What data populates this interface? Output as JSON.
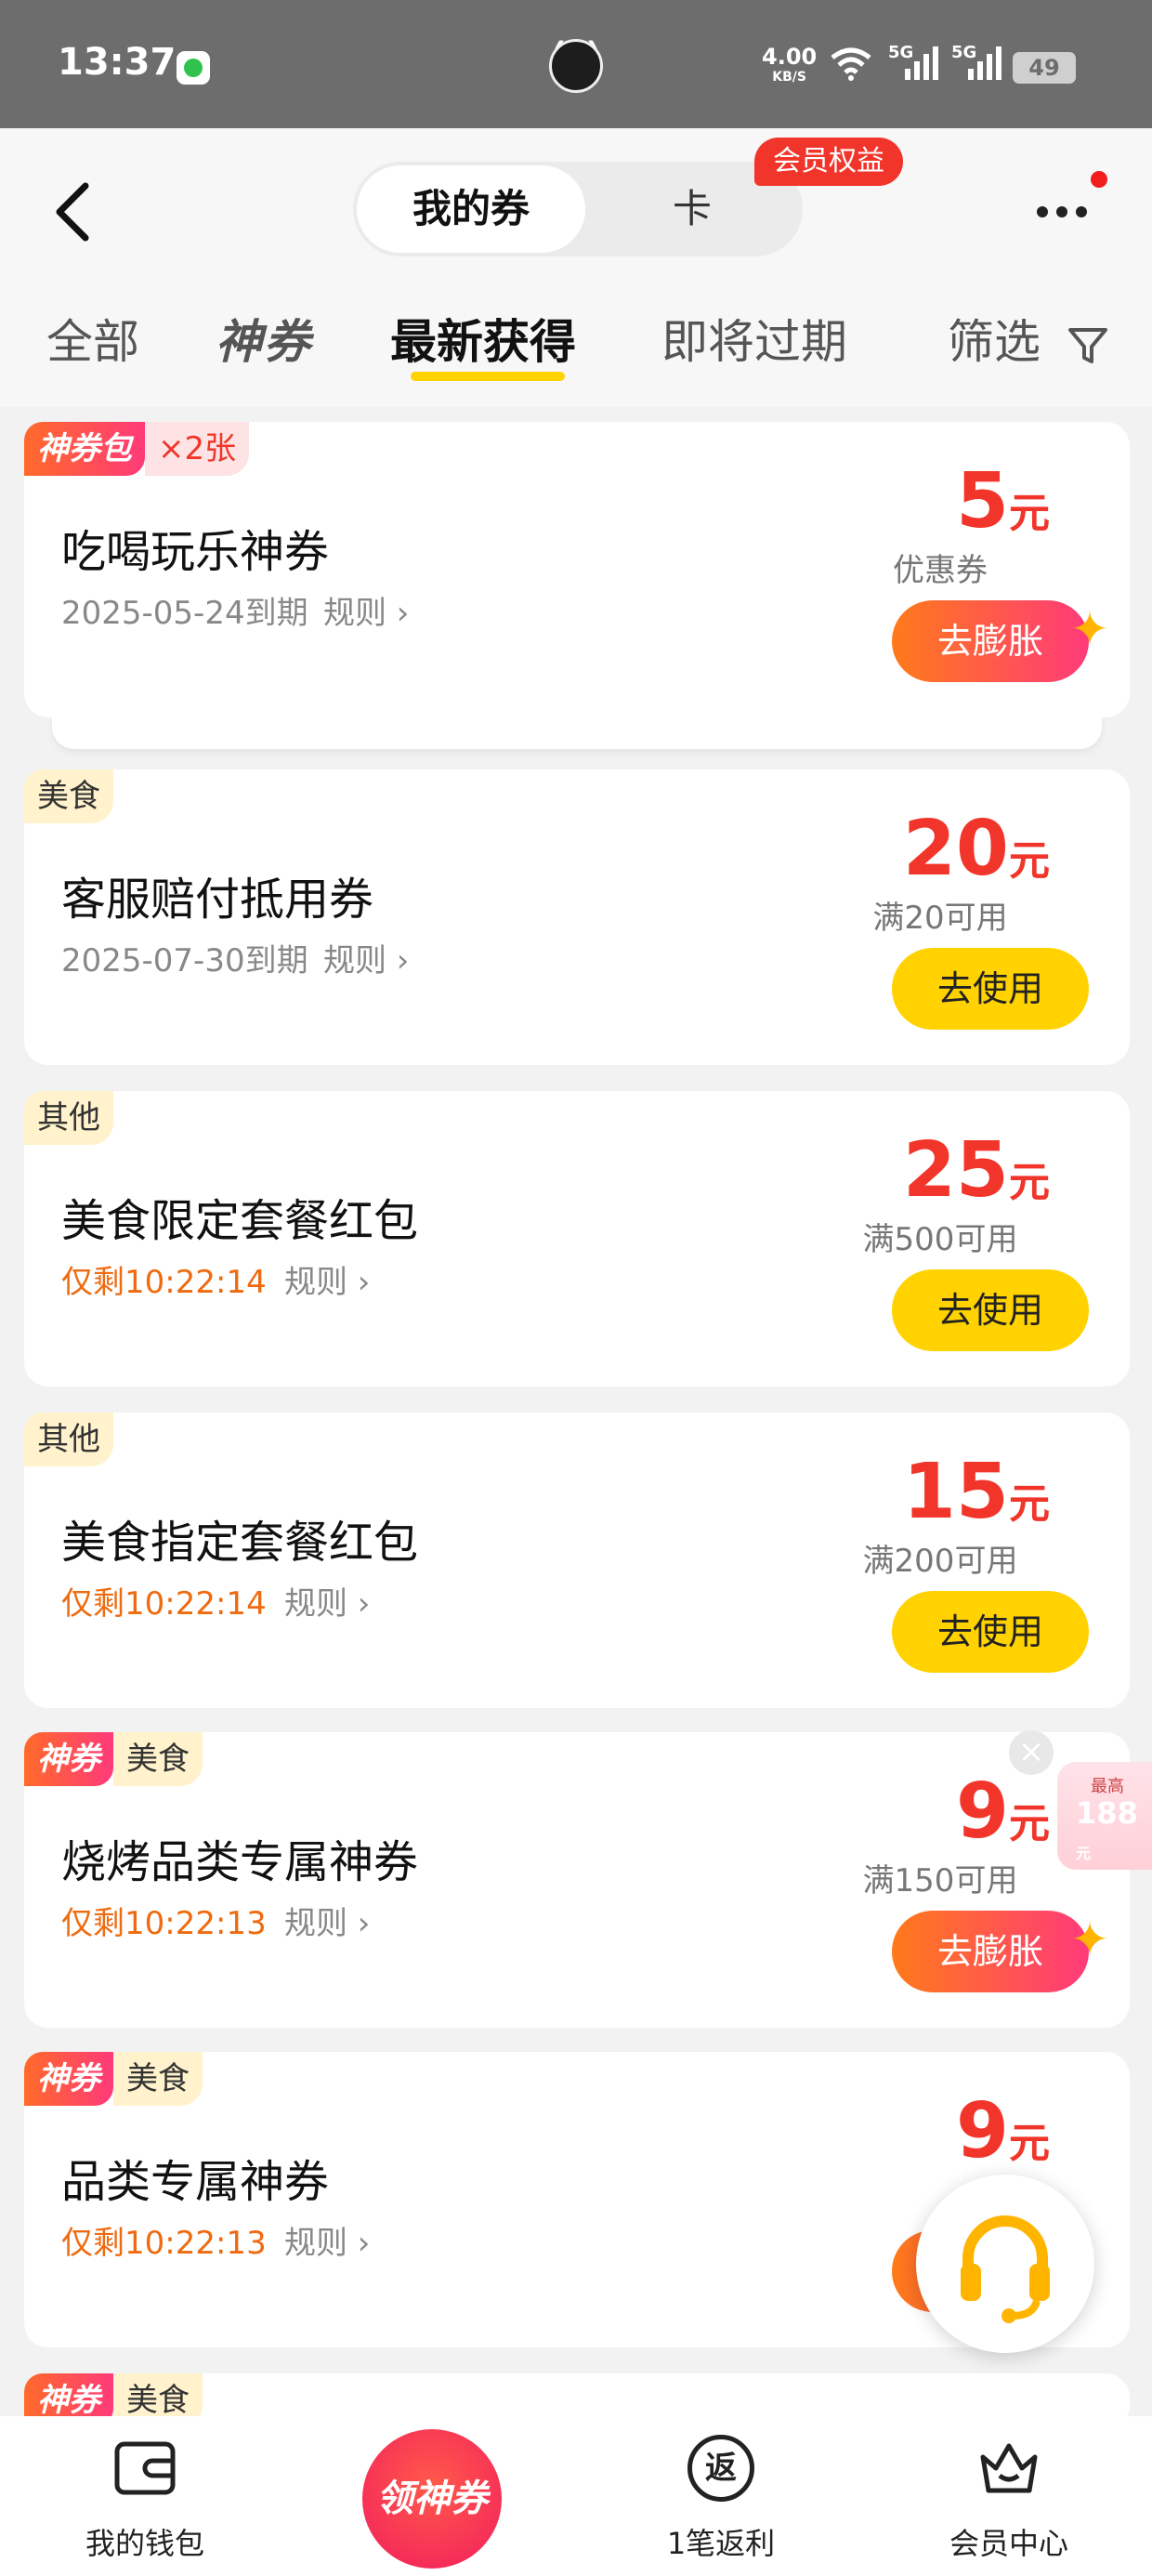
{
  "status_bar": {
    "time": "13:37",
    "net_speed": "4.00",
    "net_speed_unit": "KB/S",
    "signal1": "5G",
    "signal2": "5G",
    "battery": "49"
  },
  "header": {
    "segment_active": "我的券",
    "segment_inactive": "卡",
    "member_tag": "会员权益"
  },
  "tabs": [
    {
      "label": "全部"
    },
    {
      "label": "神券"
    },
    {
      "label": "最新获得"
    },
    {
      "label": "即将过期"
    },
    {
      "label": "筛选"
    }
  ],
  "coupons": [
    {
      "tag1": "神券包",
      "tag2": "×2张",
      "title": "吃喝玩乐神券",
      "expire": "2025-05-24到期",
      "rules": "规则",
      "amount": "5",
      "unit": "元",
      "condition": "优惠券",
      "action": "去膨胀"
    },
    {
      "tag1": "美食",
      "title": "客服赔付抵用券",
      "expire": "2025-07-30到期",
      "rules": "规则",
      "amount": "20",
      "unit": "元",
      "condition": "满20可用",
      "action": "去使用"
    },
    {
      "tag1": "其他",
      "title": "美食限定套餐红包",
      "expire": "仅剩10:22:14",
      "rules": "规则",
      "amount": "25",
      "unit": "元",
      "condition": "满500可用",
      "action": "去使用"
    },
    {
      "tag1": "其他",
      "title": "美食指定套餐红包",
      "expire": "仅剩10:22:14",
      "rules": "规则",
      "amount": "15",
      "unit": "元",
      "condition": "满200可用",
      "action": "去使用"
    },
    {
      "tag1": "神券",
      "tag2": "美食",
      "title": "烧烤品类专属神券",
      "expire": "仅剩10:22:13",
      "rules": "规则",
      "amount": "9",
      "unit": "元",
      "condition": "满150可用",
      "action": "去膨胀"
    },
    {
      "tag1": "神券",
      "tag2": "美食",
      "title": "品类专属神券",
      "expire": "仅剩10:22:13",
      "rules": "规则",
      "amount": "9",
      "unit": "元",
      "condition": "",
      "action": ""
    },
    {
      "tag1": "神券",
      "tag2": "美食"
    }
  ],
  "float_ad": {
    "top_label": "最高",
    "value": "188",
    "unit": "元"
  },
  "bottom_nav": {
    "wallet": "我的钱包",
    "center": "领神券",
    "rebate_icon": "返",
    "rebate": "1笔返利",
    "member": "会员中心"
  },
  "colors": {
    "accent_yellow": "#ffd200",
    "price_red": "#f2352a",
    "warn_orange": "#ee6b10"
  }
}
